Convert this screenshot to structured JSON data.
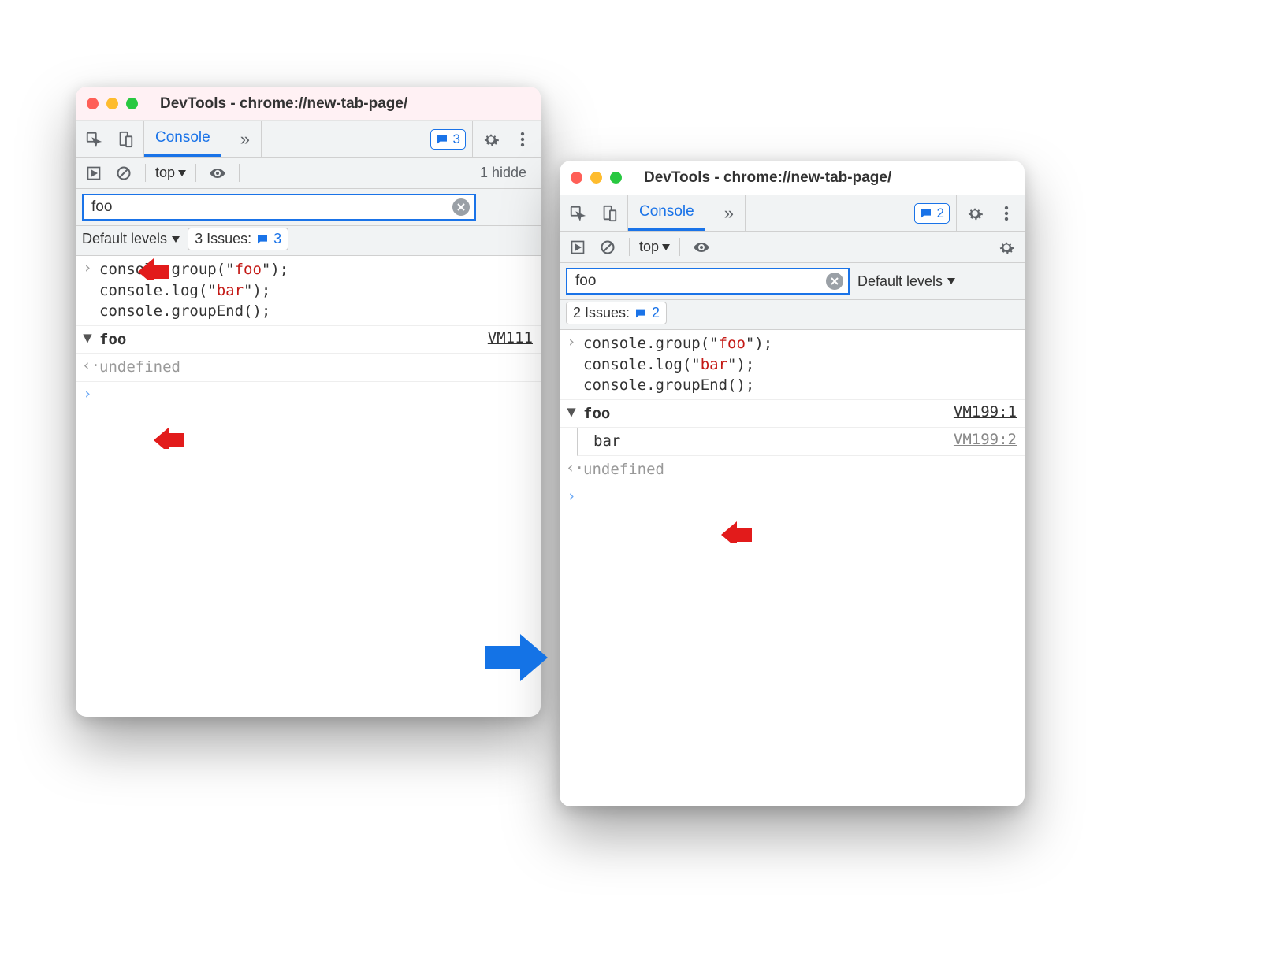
{
  "left": {
    "title": "DevTools - chrome://new-tab-page/",
    "tab": "Console",
    "badge_count": "3",
    "context": "top",
    "hidden": "1 hidde",
    "filter_value": "foo",
    "levels": "Default levels",
    "issues_label": "3 Issues:",
    "issues_count": "3",
    "code_line1": "console.group(\"",
    "code_str1": "foo",
    "code_line1_end": "\");",
    "code_line2": "console.log(\"",
    "code_str2": "bar",
    "code_line2_end": "\");",
    "code_line3": "console.groupEnd();",
    "group_name": "foo",
    "group_source": "VM111",
    "undefined": "undefined"
  },
  "right": {
    "title": "DevTools - chrome://new-tab-page/",
    "tab": "Console",
    "badge_count": "2",
    "context": "top",
    "filter_value": "foo",
    "levels": "Default levels",
    "issues_label": "2 Issues:",
    "issues_count": "2",
    "code_line1": "console.group(\"",
    "code_str1": "foo",
    "code_line1_end": "\");",
    "code_line2": "console.log(\"",
    "code_str2": "bar",
    "code_line2_end": "\");",
    "code_line3": "console.groupEnd();",
    "group_name": "foo",
    "group_source": "VM199:1",
    "bar_text": "bar",
    "bar_source": "VM199:2",
    "undefined": "undefined"
  }
}
